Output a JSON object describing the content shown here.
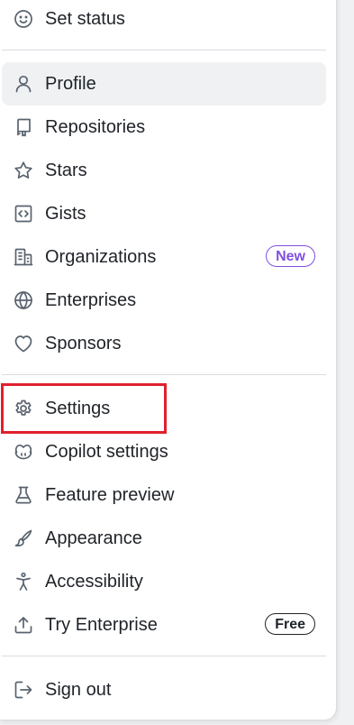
{
  "menu": {
    "set_status": "Set status",
    "profile": "Profile",
    "repositories": "Repositories",
    "stars": "Stars",
    "gists": "Gists",
    "organizations": "Organizations",
    "organizations_badge": "New",
    "enterprises": "Enterprises",
    "sponsors": "Sponsors",
    "settings": "Settings",
    "copilot_settings": "Copilot settings",
    "feature_preview": "Feature preview",
    "appearance": "Appearance",
    "accessibility": "Accessibility",
    "try_enterprise": "Try Enterprise",
    "try_enterprise_badge": "Free",
    "sign_out": "Sign out"
  },
  "icons": {
    "set_status": "smiley-icon",
    "profile": "person-icon",
    "repositories": "repo-icon",
    "stars": "star-icon",
    "gists": "code-square-icon",
    "organizations": "organization-icon",
    "enterprises": "globe-icon",
    "sponsors": "heart-icon",
    "settings": "gear-icon",
    "copilot_settings": "copilot-icon",
    "feature_preview": "beaker-icon",
    "appearance": "paintbrush-icon",
    "accessibility": "accessibility-icon",
    "try_enterprise": "upload-icon",
    "sign_out": "sign-out-icon"
  },
  "colors": {
    "badge_new": "#8250df",
    "highlight": "#e0202c",
    "active_bg": "#eff1f3"
  }
}
